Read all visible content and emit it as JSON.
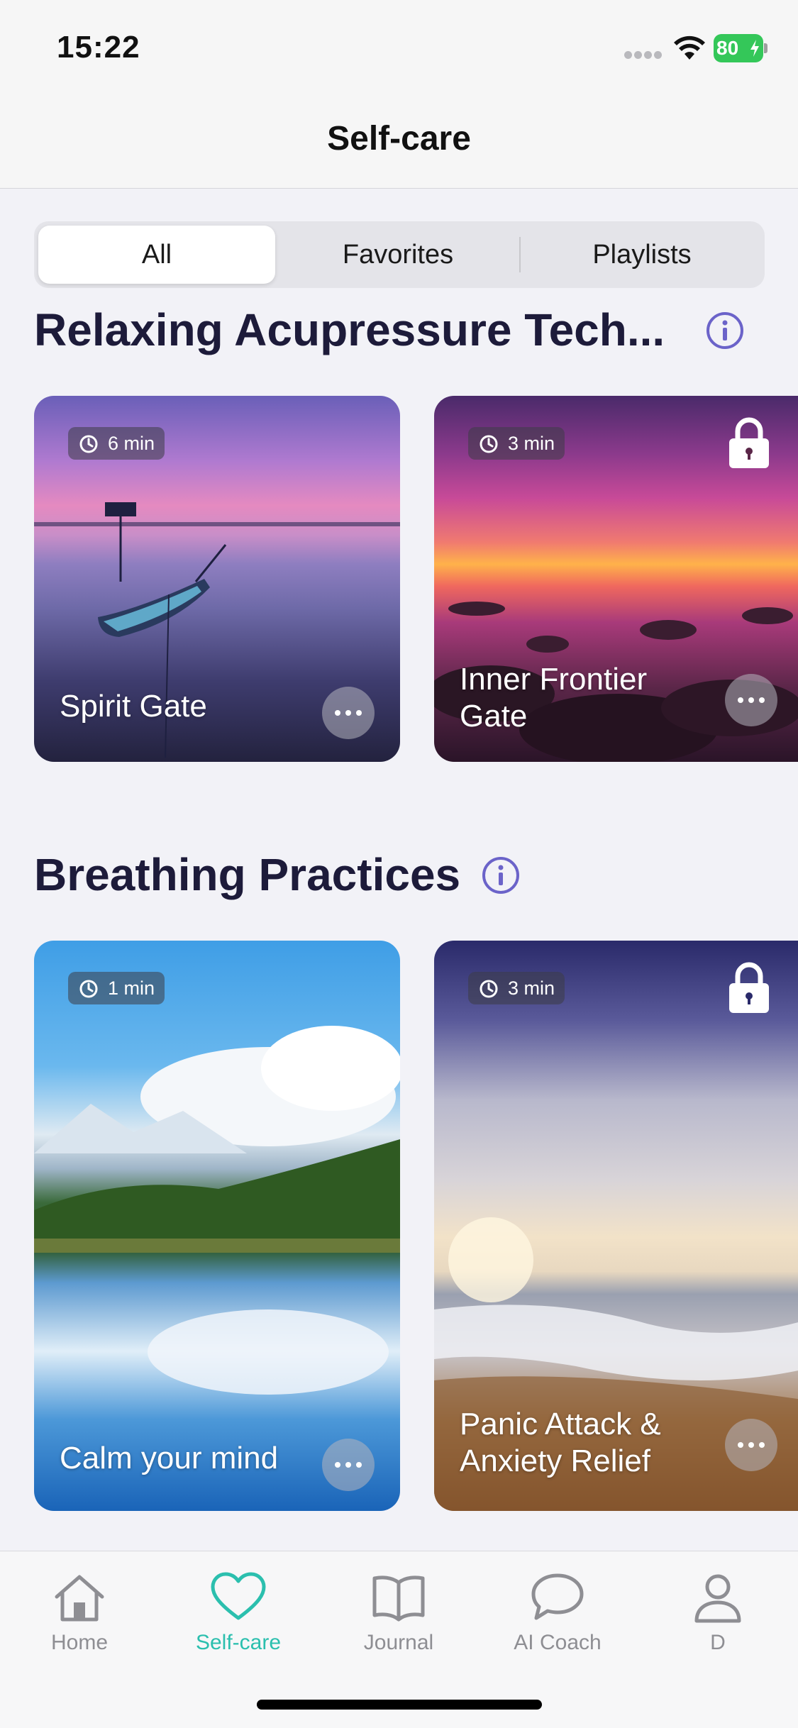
{
  "status_bar": {
    "time": "15:22",
    "battery": "80"
  },
  "header": {
    "title": "Self-care"
  },
  "segments": [
    {
      "label": "All"
    },
    {
      "label": "Favorites"
    },
    {
      "label": "Playlists"
    }
  ],
  "sections": [
    {
      "title": "Relaxing Acupressure Tech...",
      "cards": [
        {
          "duration": "6 min",
          "title": "Spirit Gate",
          "locked": false
        },
        {
          "duration": "3 min",
          "title_lines": [
            "Inner Frontier",
            "Gate"
          ],
          "locked": true
        }
      ]
    },
    {
      "title": "Breathing Practices",
      "cards": [
        {
          "duration": "1 min",
          "title": "Calm your mind",
          "locked": false
        },
        {
          "duration": "3 min",
          "title_lines": [
            "Panic Attack &",
            "Anxiety Relief"
          ],
          "locked": true
        }
      ]
    }
  ],
  "tab_bar": [
    {
      "label": "Home",
      "icon": "house-icon"
    },
    {
      "label": "Self-care",
      "icon": "heart-icon",
      "active": true
    },
    {
      "label": "Journal",
      "icon": "book-icon"
    },
    {
      "label": "AI Coach",
      "icon": "chat-bubble-icon"
    },
    {
      "label": "D",
      "icon": "person-icon"
    }
  ],
  "colors": {
    "accent": "#2bbfae",
    "heading": "#1d1b3a",
    "info": "#6b63c9"
  }
}
